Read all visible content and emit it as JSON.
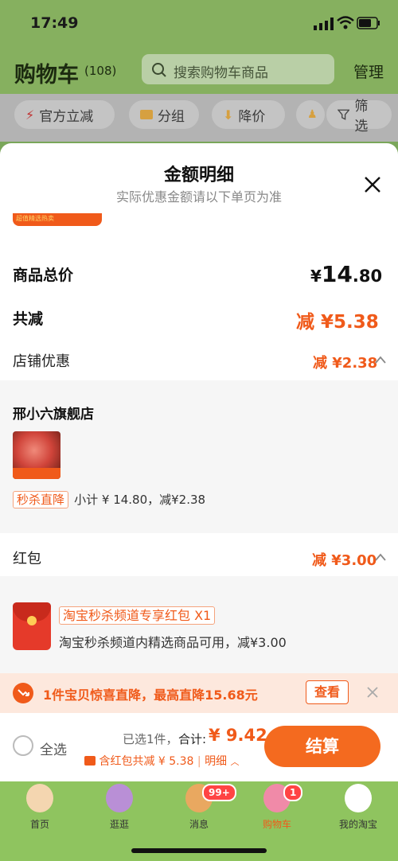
{
  "status": {
    "time": "17:49"
  },
  "header": {
    "title": "购物车",
    "count": "(108)",
    "search_placeholder": "搜索购物车商品",
    "manage": "管理"
  },
  "filters": [
    {
      "label": "官方立减",
      "icon": "lightning-icon"
    },
    {
      "label": "分组",
      "icon": "folder-icon"
    },
    {
      "label": "降价",
      "icon": "arrow-down-icon"
    },
    {
      "label": "",
      "icon": "person-icon"
    },
    {
      "label": "筛选",
      "icon": "funnel-icon"
    }
  ],
  "modal": {
    "title": "金额明细",
    "subtitle": "实际优惠金额请以下单页为准",
    "banner": "超值精选热卖",
    "goods_total_label": "商品总价",
    "goods_total_yen": "¥",
    "goods_total_int": "14",
    "goods_total_dec": ".80",
    "total_reduce_label": "共减",
    "total_reduce_value": "减 ¥5.38",
    "shop_discount_label": "店铺优惠",
    "shop_discount_value": "减 ¥2.38",
    "shop_name": "邢小六旗舰店",
    "product_tag": "秒杀直降",
    "product_subtotal": "小计 ¥ 14.80，减¥2.38",
    "redpacket_label": "红包",
    "redpacket_value": "减 ¥3.00",
    "redpacket_title": "淘宝秒杀频道专享红包 X1",
    "redpacket_desc": "淘宝秒杀频道内精选商品可用，减¥3.00"
  },
  "promo": {
    "text": "1件宝贝惊喜直降，最高直降15.68元",
    "button": "查看"
  },
  "bottom": {
    "select_all": "全选",
    "selected": "已选1件，",
    "total_label": "合计:",
    "total_value": "¥ 9.42",
    "hongbao": "含红包共减 ¥ 5.38",
    "detail": "明细",
    "checkout": "结算"
  },
  "tabs": [
    {
      "label": "首页",
      "badge": ""
    },
    {
      "label": "逛逛",
      "badge": ""
    },
    {
      "label": "消息",
      "badge": "99+"
    },
    {
      "label": "购物车",
      "badge": "1"
    },
    {
      "label": "我的淘宝",
      "badge": ""
    }
  ],
  "colors": {
    "accent": "#f05a1a",
    "header_bg": "#86b05f",
    "tab_bg": "#8fc45f"
  }
}
